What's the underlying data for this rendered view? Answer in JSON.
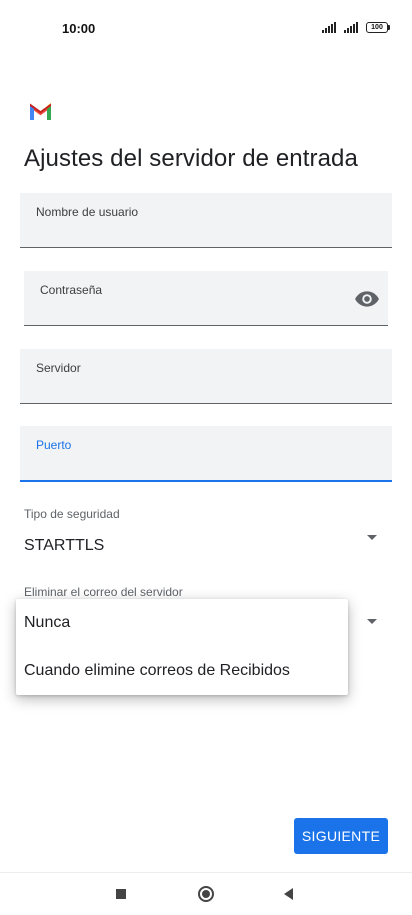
{
  "status_bar": {
    "time": "10:00",
    "battery": "100",
    "signal_icon": "signal-bars-icon"
  },
  "app": {
    "logo_icon": "gmail-icon",
    "title": "Ajustes del servidor de entrada"
  },
  "form": {
    "username": {
      "label": "Nombre de usuario",
      "value": ""
    },
    "password": {
      "label": "Contraseña",
      "value": "",
      "toggle_icon": "eye-icon"
    },
    "server": {
      "label": "Servidor",
      "value": ""
    },
    "port": {
      "label": "Puerto",
      "value": ""
    },
    "security": {
      "label": "Tipo de seguridad",
      "value": "STARTTLS"
    },
    "delete_from_server": {
      "label": "Eliminar el correo del servidor"
    }
  },
  "popup_menu": {
    "items": [
      "Nunca",
      "Cuando elimine correos de Recibidos"
    ]
  },
  "actions": {
    "next_label": "SIGUIENTE"
  },
  "nav_bar": {
    "recents_icon": "square-icon",
    "home_icon": "circle-icon",
    "back_icon": "triangle-back-icon"
  },
  "colors": {
    "accent": "#1a73e8",
    "field_bg": "#f1f3f4"
  }
}
